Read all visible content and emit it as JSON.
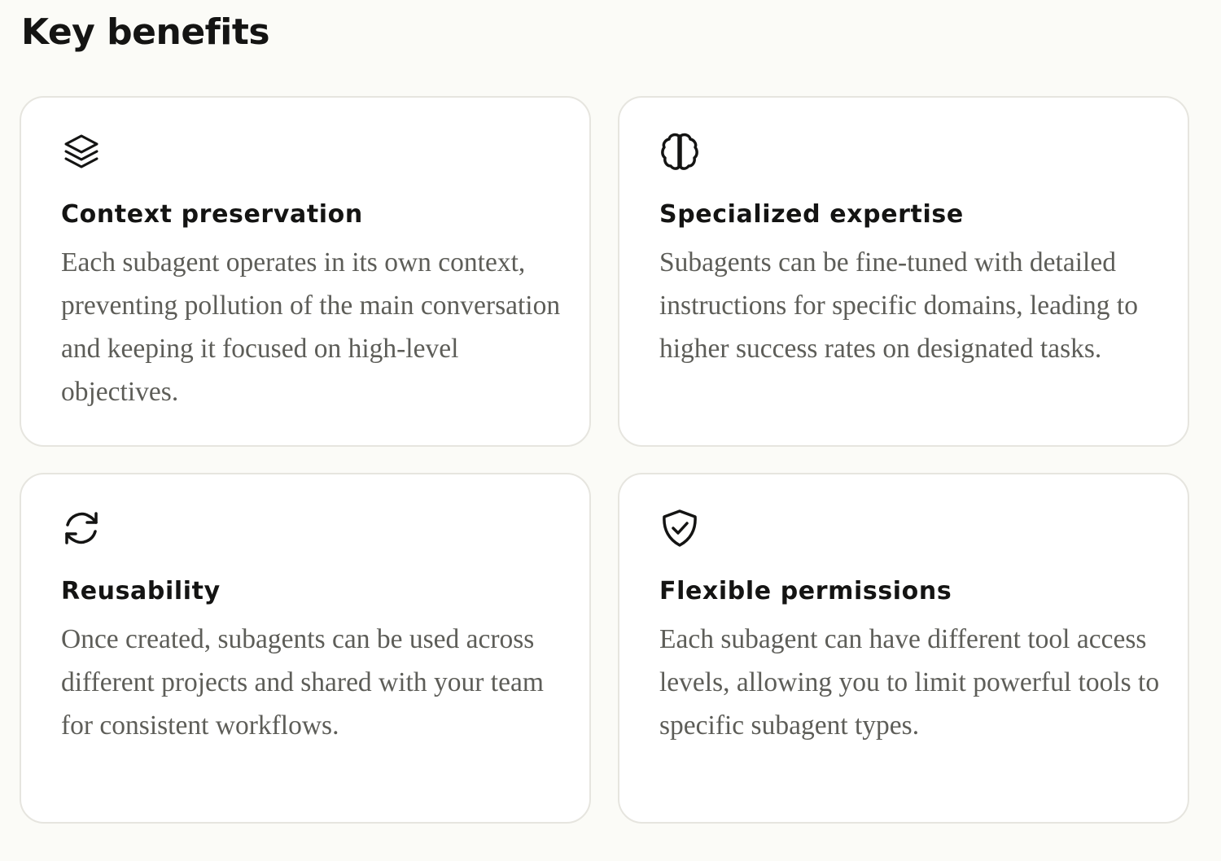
{
  "page": {
    "title": "Key benefits"
  },
  "cards": [
    {
      "icon": "layers-icon",
      "title": "Context preservation",
      "description": "Each subagent operates in its own context, preventing pollution of the main conversation and keeping it focused on high-level objectives."
    },
    {
      "icon": "brain-icon",
      "title": "Specialized expertise",
      "description": "Subagents can be fine-tuned with detailed instructions for specific domains, leading to higher success rates on designated tasks."
    },
    {
      "icon": "refresh-icon",
      "title": "Reusability",
      "description": "Once created, subagents can be used across different projects and shared with your team for consistent workflows."
    },
    {
      "icon": "shield-check-icon",
      "title": "Flexible permissions",
      "description": "Each subagent can have different tool access levels, allowing you to limit powerful tools to specific subagent types."
    }
  ],
  "colors": {
    "background": "#fbfbf7",
    "card_background": "#ffffff",
    "card_border": "#e6e5df",
    "heading": "#141413",
    "body_text": "#5d5d58"
  }
}
